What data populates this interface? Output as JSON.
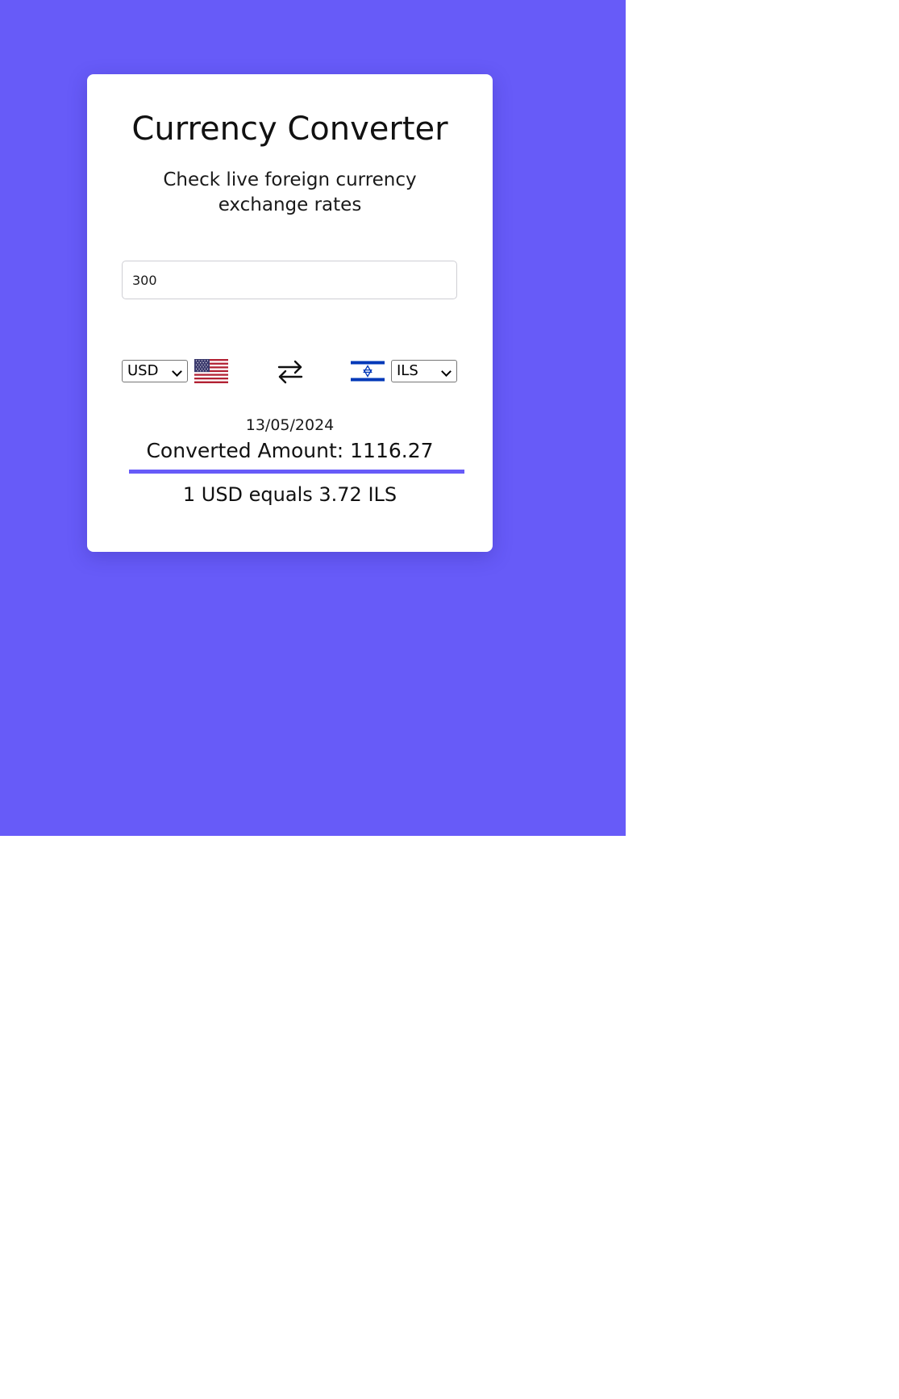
{
  "colors": {
    "background": "#675bf8",
    "card": "#ffffff",
    "accent": "#675bf8"
  },
  "converter": {
    "title": "Currency Converter",
    "subtitle": "Check live foreign currency exchange rates",
    "amount_value": "300",
    "from_currency": "USD",
    "from_flag_icon": "us-flag-icon",
    "to_currency": "ILS",
    "to_flag_icon": "israel-flag-icon",
    "swap_icon": "swap-arrows-icon",
    "date": "13/05/2024",
    "converted_amount_text": "Converted Amount: 1116.27",
    "rate_text": "1 USD equals 3.72 ILS"
  }
}
